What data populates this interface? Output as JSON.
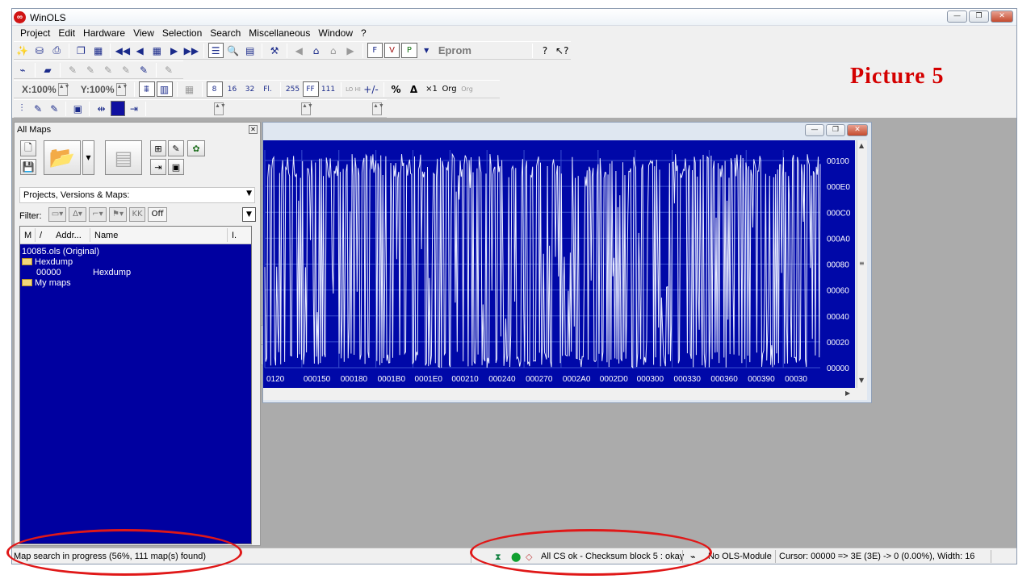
{
  "window": {
    "title": "WinOLS",
    "logo_glyph": "∞",
    "buttons": {
      "minimize": "—",
      "maximize": "❐",
      "close": "✕"
    }
  },
  "annotation": {
    "label": "Picture 5",
    "ring_color": "#e01818"
  },
  "menu": [
    "Project",
    "Edit",
    "Hardware",
    "View",
    "Selection",
    "Search",
    "Miscellaneous",
    "Window",
    "?"
  ],
  "toolbar": {
    "eprom_label": "Eprom",
    "x_zoom": "X:100%",
    "y_zoom": "Y:100%",
    "format_buttons": {
      "b8": "8",
      "b16": "16",
      "b32": "32",
      "fl": "Fl.",
      "dec255": "255",
      "hexff": "FF",
      "bin": "111",
      "pct": "%",
      "delta": "Δ",
      "x1": "×1",
      "orig": "Org"
    },
    "icons": [
      "wand-icon",
      "cylinder-icon",
      "printer-icon",
      "copy-window-icon",
      "layout-icon",
      "rewind-icon",
      "back-icon",
      "grid-icon",
      "play-icon",
      "fast-forward-icon",
      "text-view-icon",
      "search-icon",
      "scroll-icon",
      "tools-icon",
      "help-icon",
      "context-help-icon"
    ]
  },
  "maps_panel": {
    "title": "All Maps",
    "projects_select": "Projects, Versions & Maps:",
    "filter_label": "Filter:",
    "filter_off": "Off",
    "columns": [
      "M",
      "/",
      "Addr...",
      "Name",
      "I."
    ],
    "tree": [
      {
        "label": "10085.ols (Original)",
        "type": "project"
      },
      {
        "label": "Hexdump",
        "type": "folder"
      },
      {
        "address": "00000",
        "name": "Hexdump",
        "type": "map"
      },
      {
        "label": "My maps",
        "type": "folder"
      }
    ]
  },
  "view": {
    "background": "#0008a8",
    "x_labels": [
      "0120",
      "000150",
      "000180",
      "0001B0",
      "0001E0",
      "000210",
      "000240",
      "000270",
      "0002A0",
      "0002D0",
      "000300",
      "000330",
      "000360",
      "000390",
      "00030"
    ],
    "y_labels": [
      "00100",
      "000E0",
      "000C0",
      "000A0",
      "00080",
      "00060",
      "00040",
      "00020",
      "00000"
    ]
  },
  "status": {
    "left": "Map search in progress (56%, 111 map(s) found)",
    "checksum": "All CS ok - Checksum block 5 : okay",
    "module": "No OLS-Module",
    "cursor": "Cursor: 00000 => 3E (3E) -> 0 (0.00%), Width: 16"
  }
}
